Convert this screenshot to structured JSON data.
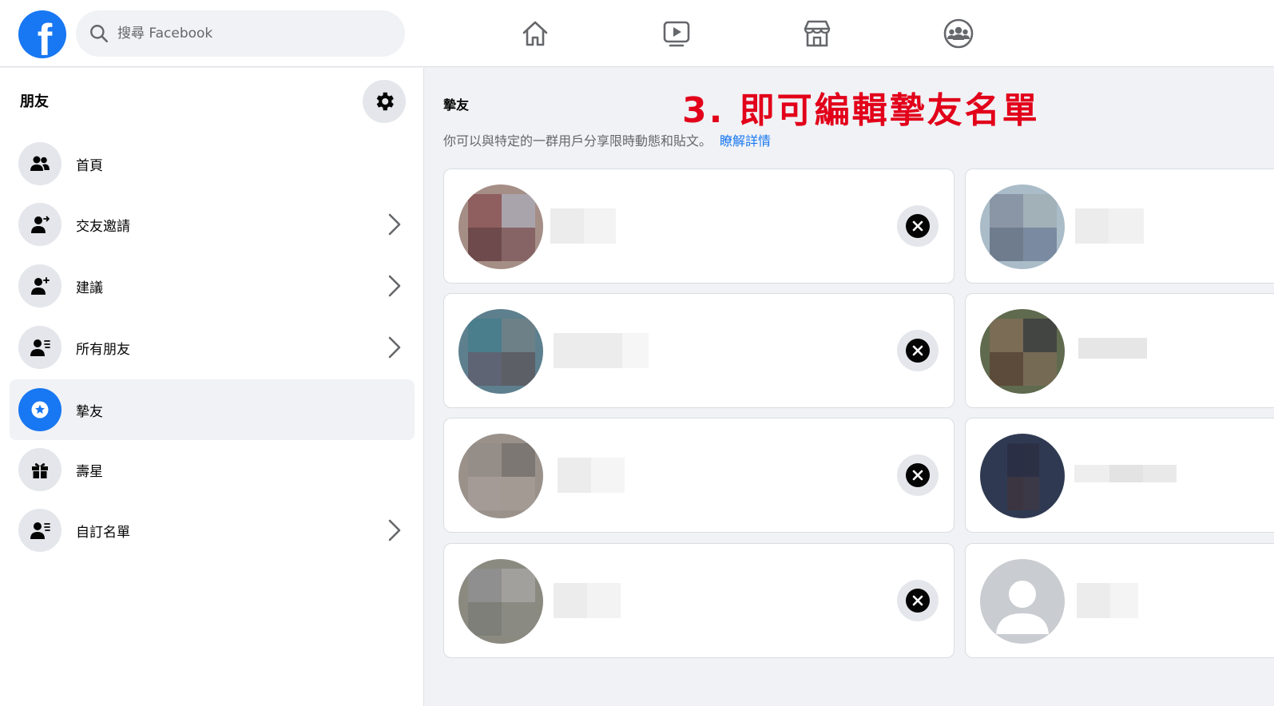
{
  "topbar": {
    "logo_letter": "f",
    "search_placeholder": "搜尋 Facebook",
    "nav": [
      "home-icon",
      "watch-icon",
      "marketplace-icon",
      "groups-icon"
    ]
  },
  "sidebar": {
    "title": "朋友",
    "items": [
      {
        "label": "首頁",
        "icon": "friends-icon",
        "chevron": false,
        "active": false
      },
      {
        "label": "交友邀請",
        "icon": "friend-request-icon",
        "chevron": true,
        "active": false
      },
      {
        "label": "建議",
        "icon": "add-friend-icon",
        "chevron": true,
        "active": false
      },
      {
        "label": "所有朋友",
        "icon": "friend-list-icon",
        "chevron": true,
        "active": false
      },
      {
        "label": "摯友",
        "icon": "star-icon",
        "chevron": false,
        "active": true
      },
      {
        "label": "壽星",
        "icon": "gift-icon",
        "chevron": false,
        "active": false
      },
      {
        "label": "自訂名單",
        "icon": "custom-list-icon",
        "chevron": true,
        "active": false
      }
    ]
  },
  "main": {
    "title": "摯友",
    "annotation": "3. 即可編輯摯友名單",
    "description": "你可以與特定的一群用戶分享限時動態和貼文。",
    "learn_more": "瞭解詳情"
  },
  "colors": {
    "brand": "#1877f2",
    "annotation": "#e2001a",
    "background": "#f0f2f5"
  }
}
